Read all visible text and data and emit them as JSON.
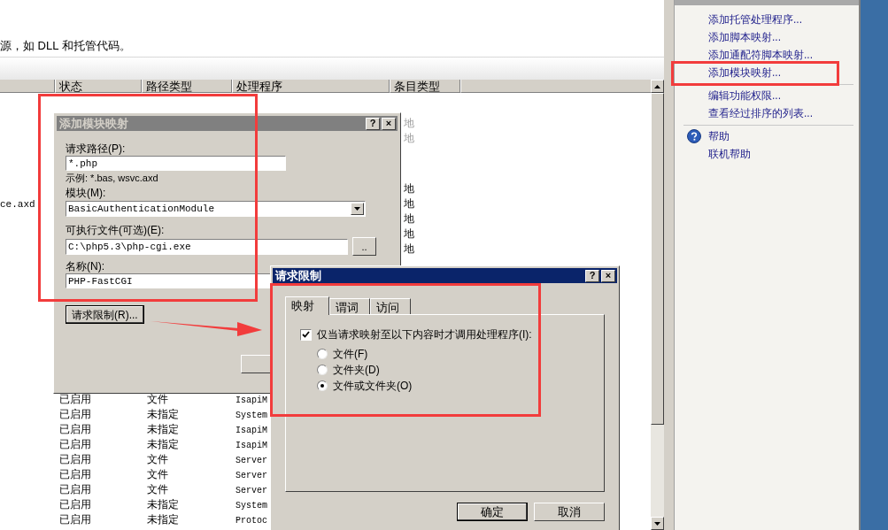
{
  "description": "源，如 DLL 和托管代码。",
  "table": {
    "columns": [
      {
        "label": "状态"
      },
      {
        "label": "路径类型"
      },
      {
        "label": "处理程序"
      },
      {
        "label": "条目类型"
      }
    ],
    "rows_upper": [
      {
        "entry_type": "地",
        "disabled": true
      },
      {
        "entry_type": "地",
        "disabled": true
      }
    ],
    "rows_middle": [
      {
        "entry_type": "地",
        "disabled": false
      },
      {
        "name": "ce.axd",
        "entry_type": "地",
        "disabled": false
      },
      {
        "entry_type": "地",
        "disabled": false
      },
      {
        "entry_type": "地",
        "disabled": false
      },
      {
        "entry_type": "地",
        "disabled": false
      }
    ],
    "rows_lower": [
      {
        "status": "已启用",
        "path_type": "文件",
        "handler": "IsapiM",
        "disabled": false
      },
      {
        "status": "已启用",
        "path_type": "未指定",
        "handler": "System",
        "disabled": false
      },
      {
        "status": "已启用",
        "path_type": "未指定",
        "handler": "IsapiM",
        "disabled": false
      },
      {
        "status": "已启用",
        "path_type": "未指定",
        "handler": "IsapiM",
        "disabled": false
      },
      {
        "status": "已启用",
        "path_type": "文件",
        "handler": "Server",
        "disabled": false
      },
      {
        "status": "已启用",
        "path_type": "文件",
        "handler": "Server",
        "disabled": false
      },
      {
        "status": "已启用",
        "path_type": "文件",
        "handler": "Server",
        "disabled": false
      },
      {
        "status": "已启用",
        "path_type": "未指定",
        "handler": "System",
        "disabled": false
      },
      {
        "status": "已启用",
        "path_type": "未指定",
        "handler": "Protoc",
        "disabled": false
      }
    ]
  },
  "actions": {
    "items": [
      {
        "kind": "link",
        "label": "添加托管处理程序..."
      },
      {
        "kind": "link",
        "label": "添加脚本映射..."
      },
      {
        "kind": "link",
        "label": "添加通配符脚本映射..."
      },
      {
        "kind": "link",
        "label": "添加模块映射..."
      },
      {
        "kind": "separator"
      },
      {
        "kind": "link",
        "label": "编辑功能权限..."
      },
      {
        "kind": "link",
        "label": "查看经过排序的列表..."
      },
      {
        "kind": "separator"
      },
      {
        "kind": "help",
        "label": "帮助"
      },
      {
        "kind": "link",
        "label": "联机帮助"
      }
    ]
  },
  "module_mapping_dialog": {
    "title": "添加模块映射",
    "active": false,
    "title_buttons": [
      "?",
      "×"
    ],
    "fields": [
      {
        "kind": "text",
        "label": "请求路径(P):",
        "value": "*.php",
        "hint": "示例: *.bas, wsvc.axd"
      },
      {
        "kind": "select",
        "label": "模块(M):",
        "value": "BasicAuthenticationModule"
      },
      {
        "kind": "browse",
        "label": "可执行文件(可选)(E):",
        "value": "C:\\php5.3\\php-cgi.exe",
        "browse_label": ".."
      },
      {
        "kind": "text",
        "label": "名称(N):",
        "value": "PHP-FastCGI"
      }
    ],
    "restrictions_button": "请求限制(R)..."
  },
  "restrictions_dialog": {
    "title": "请求限制",
    "active": true,
    "title_buttons": [
      "?",
      "×"
    ],
    "tabs": [
      {
        "label": "映射",
        "selected": true
      },
      {
        "label": "谓词",
        "selected": false
      },
      {
        "label": "访问",
        "selected": false
      }
    ],
    "invoke_only": {
      "label": "仅当请求映射至以下内容时才调用处理程序(I):",
      "checked": true
    },
    "options": [
      {
        "label": "文件(F)",
        "selected": false
      },
      {
        "label": "文件夹(D)",
        "selected": false
      },
      {
        "label": "文件或文件夹(O)",
        "selected": true
      }
    ],
    "buttons": [
      "确定",
      "取消"
    ]
  }
}
